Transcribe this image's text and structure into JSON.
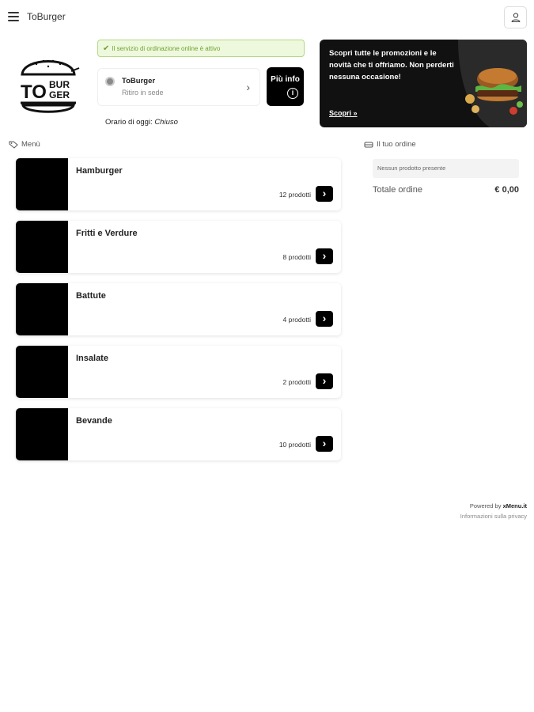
{
  "header": {
    "app_title": "ToBurger",
    "menu_icon": "hamburger-menu-icon",
    "user_icon": "user-icon"
  },
  "logo": {
    "text_to": "TO",
    "text_bur": "BUR",
    "text_ger": "GER"
  },
  "store": {
    "status_text": "Il servizio di ordinazione online è attivo",
    "name": "ToBurger",
    "mode": "Ritiro in sede",
    "info_button": "Più info",
    "hours_label": "Orario di oggi:",
    "hours_value": "Chiuso"
  },
  "promo": {
    "text": "Scopri tutte le promozioni e le novità che ti offriamo. Non perderti nessuna occasione!",
    "cta": "Scopri »"
  },
  "menu": {
    "section_label": "Menù",
    "categories": [
      {
        "name": "Hamburger",
        "count": "12 prodotti"
      },
      {
        "name": "Fritti e Verdure",
        "count": "8 prodotti"
      },
      {
        "name": "Battute",
        "count": "4 prodotti"
      },
      {
        "name": "Insalate",
        "count": "2 prodotti"
      },
      {
        "name": "Bevande",
        "count": "10 prodotti"
      }
    ]
  },
  "order": {
    "section_label": "Il tuo ordine",
    "empty_text": "Nessun prodotto presente",
    "total_label": "Totale ordine",
    "total_value": "€ 0,00"
  },
  "footer": {
    "powered_by": "Powered by",
    "brand": "xMenu.it",
    "privacy": "Informazioni sulla privacy"
  },
  "colors": {
    "status_green": "#6ea332",
    "accent_black": "#000000"
  }
}
